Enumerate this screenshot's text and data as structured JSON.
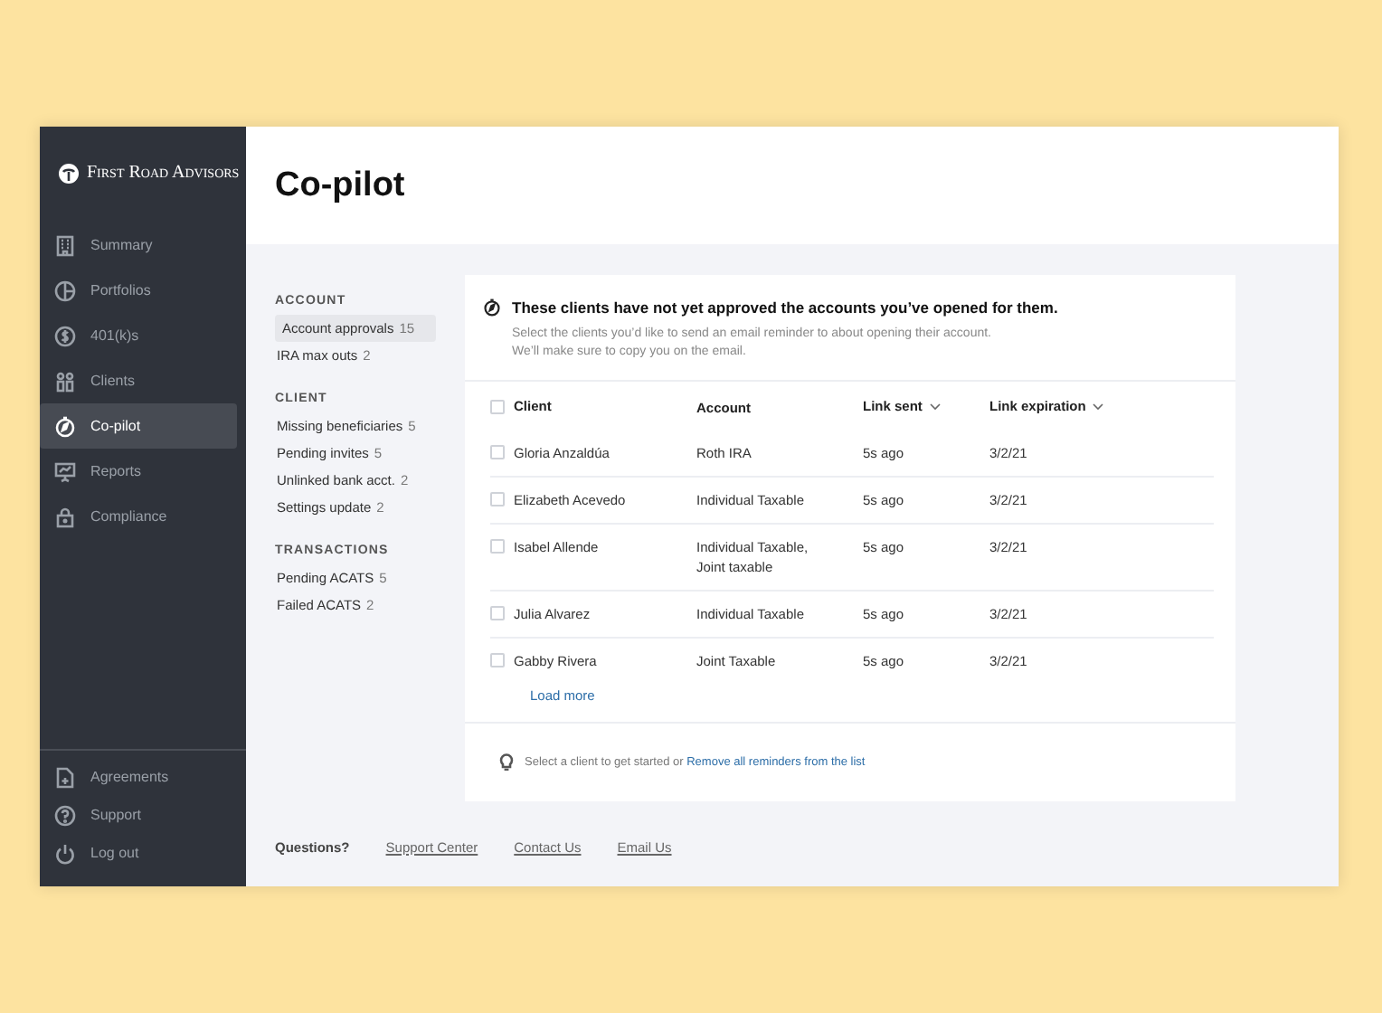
{
  "brand": {
    "name": "First Road Advisors"
  },
  "sidebar": {
    "items": [
      {
        "label": "Summary",
        "selected": false
      },
      {
        "label": "Portfolios",
        "selected": false
      },
      {
        "label": "401(k)s",
        "selected": false
      },
      {
        "label": "Clients",
        "selected": false
      },
      {
        "label": "Co-pilot",
        "selected": true
      },
      {
        "label": "Reports",
        "selected": false
      },
      {
        "label": "Compliance",
        "selected": false
      }
    ],
    "footer_items": [
      {
        "label": "Agreements"
      },
      {
        "label": "Support"
      },
      {
        "label": "Log out"
      }
    ]
  },
  "page": {
    "title": "Co-pilot"
  },
  "subnav": [
    {
      "heading": "ACCOUNT",
      "items": [
        {
          "label": "Account approvals",
          "count": "15",
          "selected": true
        },
        {
          "label": "IRA max outs",
          "count": "2",
          "selected": false
        }
      ]
    },
    {
      "heading": "CLIENT",
      "items": [
        {
          "label": "Missing beneficiaries",
          "count": "5",
          "selected": false
        },
        {
          "label": "Pending invites",
          "count": "5",
          "selected": false
        },
        {
          "label": "Unlinked bank acct.",
          "count": "2",
          "selected": false
        },
        {
          "label": "Settings update",
          "count": "2",
          "selected": false
        }
      ]
    },
    {
      "heading": "TRANSACTIONS",
      "items": [
        {
          "label": "Pending ACATS",
          "count": "5",
          "selected": false
        },
        {
          "label": "Failed ACATS",
          "count": "2",
          "selected": false
        }
      ]
    }
  ],
  "card": {
    "title": "These clients have not yet approved the accounts you’ve opened for them.",
    "description": [
      "Select the clients you’d like to send an email reminder to about opening their account.",
      "We’ll make sure to copy you on the email."
    ],
    "table": {
      "select_all": {
        "checked": false
      },
      "columns": [
        {
          "label": "Client",
          "sortable": false
        },
        {
          "label": "Account",
          "sortable": false
        },
        {
          "label": "Link sent",
          "sortable": true
        },
        {
          "label": "Link expiration",
          "sortable": true
        }
      ],
      "rows": [
        {
          "checked": false,
          "client": "Gloria Anzaldúa",
          "account": [
            "Roth IRA"
          ],
          "link_sent": "5s ago",
          "link_expiration": "3/2/21"
        },
        {
          "checked": false,
          "client": "Elizabeth Acevedo",
          "account": [
            "Individual Taxable"
          ],
          "link_sent": "5s ago",
          "link_expiration": "3/2/21"
        },
        {
          "checked": false,
          "client": "Isabel Allende",
          "account": [
            "Individual Taxable,",
            "Joint taxable"
          ],
          "link_sent": "5s ago",
          "link_expiration": "3/2/21"
        },
        {
          "checked": false,
          "client": "Julia Alvarez",
          "account": [
            "Individual Taxable"
          ],
          "link_sent": "5s ago",
          "link_expiration": "3/2/21"
        },
        {
          "checked": false,
          "client": "Gabby Rivera",
          "account": [
            "Joint Taxable"
          ],
          "link_sent": "5s ago",
          "link_expiration": "3/2/21"
        }
      ]
    },
    "load_more": "Load more",
    "hint": {
      "text": "Select a client to get started or",
      "link": "Remove all reminders from the list"
    }
  },
  "help": {
    "label": "Questions?",
    "links": [
      "Support Center",
      "Contact Us",
      "Email Us"
    ]
  }
}
